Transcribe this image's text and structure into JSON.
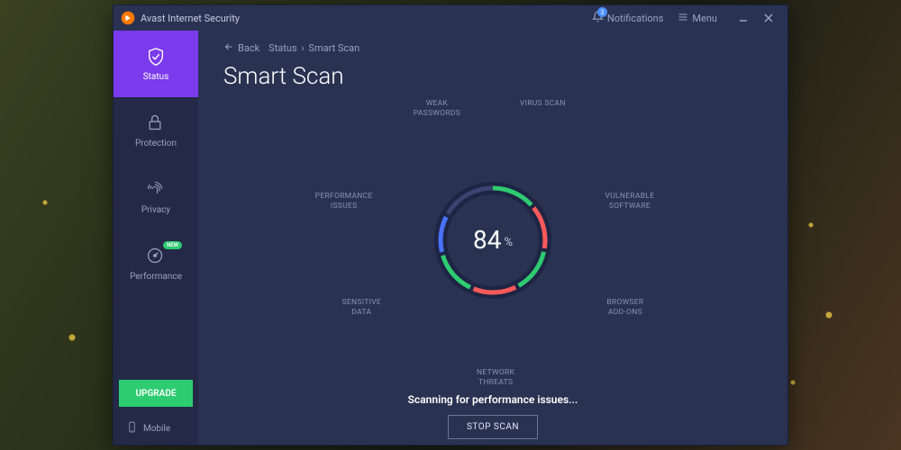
{
  "app_title": "Avast Internet Security",
  "titlebar": {
    "notifications_label": "Notifications",
    "notifications_count": "3",
    "menu_label": "Menu"
  },
  "sidebar": {
    "items": [
      {
        "label": "Status",
        "icon": "shield-check-icon",
        "active": true
      },
      {
        "label": "Protection",
        "icon": "lock-icon"
      },
      {
        "label": "Privacy",
        "icon": "fingerprint-icon"
      },
      {
        "label": "Performance",
        "icon": "gauge-icon",
        "badge": "NEW"
      }
    ],
    "upgrade_label": "UPGRADE",
    "mobile_label": "Mobile"
  },
  "breadcrumb": {
    "back_label": "Back",
    "path": [
      "Status",
      "Smart Scan"
    ]
  },
  "page_title": "Smart Scan",
  "scan": {
    "percent": "84",
    "percent_symbol": "%",
    "categories": [
      {
        "label": "VIRUS SCAN"
      },
      {
        "label": "VULNERABLE\nSOFTWARE"
      },
      {
        "label": "BROWSER\nADD-ONS"
      },
      {
        "label": "NETWORK\nTHREATS"
      },
      {
        "label": "SENSITIVE\nDATA"
      },
      {
        "label": "PERFORMANCE\nISSUES"
      },
      {
        "label": "WEAK\nPASSWORDS"
      }
    ],
    "status_text": "Scanning for performance issues...",
    "stop_label": "STOP SCAN"
  },
  "colors": {
    "accent_purple": "#7c3aed",
    "accent_green": "#2ecc71",
    "ring_green": "#2ecc71",
    "ring_red": "#ff5a5a",
    "ring_blue": "#4a72ff",
    "ring_idle": "#3a4470"
  }
}
